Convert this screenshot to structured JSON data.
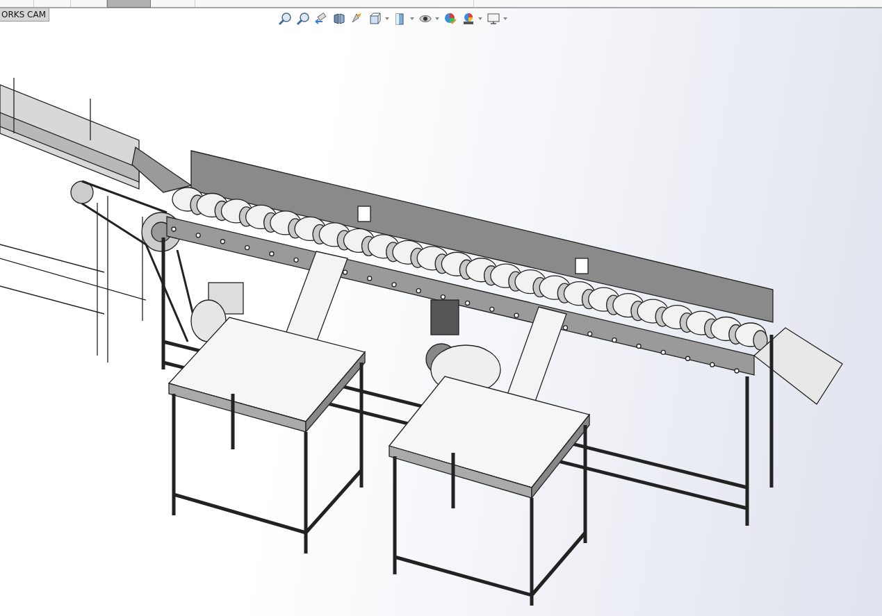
{
  "command_tabs": [
    {
      "selected": false
    },
    {
      "selected": false
    },
    {
      "selected": false
    },
    {
      "selected": true
    },
    {
      "selected": false
    },
    {
      "selected": false
    }
  ],
  "addin_tab": {
    "label": "ORKS CAM"
  }
}
